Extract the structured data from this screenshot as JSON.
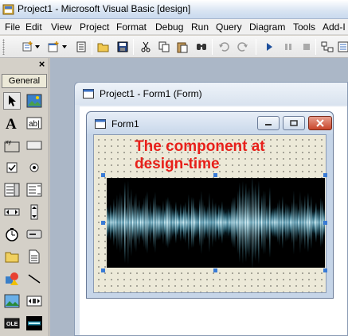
{
  "window": {
    "title": "Project1 - Microsoft Visual Basic [design]"
  },
  "menu": {
    "items": [
      "File",
      "Edit",
      "View",
      "Project",
      "Format",
      "Debug",
      "Run",
      "Query",
      "Diagram",
      "Tools",
      "Add-I"
    ]
  },
  "toolbar": {
    "icons": [
      "add-project-icon",
      "add-form-icon",
      "menu-editor-icon",
      "open-icon",
      "save-icon",
      "cut-icon",
      "copy-icon",
      "paste-icon",
      "find-icon",
      "undo-icon",
      "redo-icon",
      "start-icon",
      "break-icon",
      "end-icon",
      "project-explorer-icon"
    ]
  },
  "toolbox": {
    "close_label": "×",
    "tab_label": "General",
    "tools": [
      "pointer",
      "picturebox",
      "label",
      "textbox",
      "frame",
      "commandbutton",
      "checkbox",
      "optionbutton",
      "combobox",
      "listbox",
      "hscrollbar",
      "vscrollbar",
      "timer",
      "drivelistbox",
      "dirlistbox",
      "filelistbox",
      "shape",
      "line",
      "image",
      "data",
      "ole",
      "custom-control"
    ]
  },
  "project_window": {
    "title": "Project1 - Form1 (Form)"
  },
  "form_window": {
    "title": "Form1",
    "caption": "The component at design-time",
    "caption_line1": "The component at",
    "caption_line2": "design-time"
  },
  "colors": {
    "caption_red": "#e8201a",
    "selection_handle": "#3a7bd5",
    "wave_glow": "#39c9ff"
  }
}
